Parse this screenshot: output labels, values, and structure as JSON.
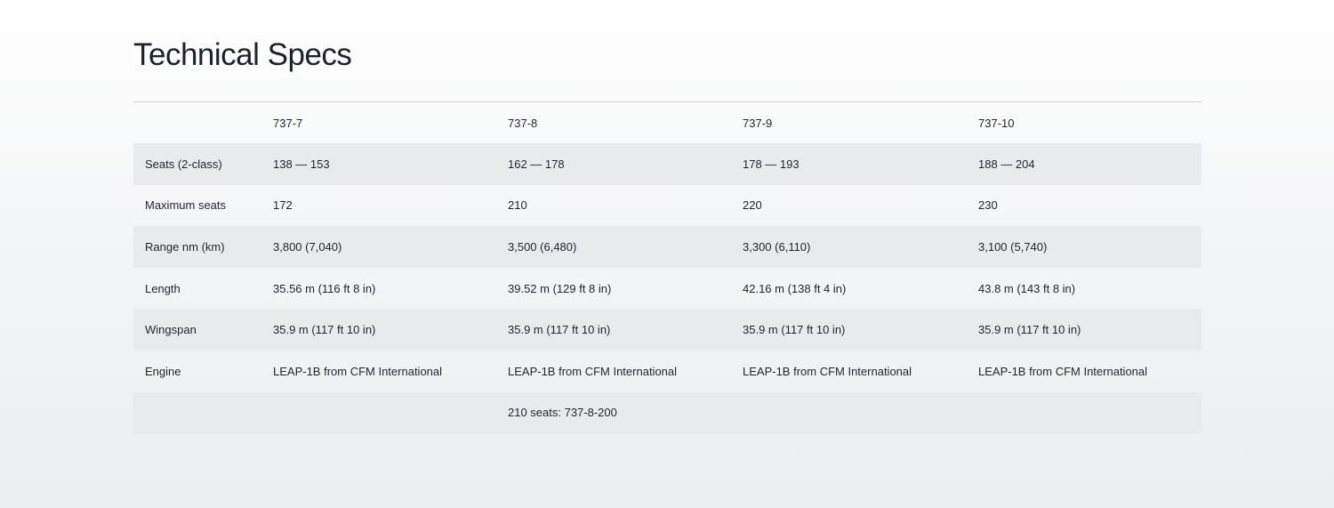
{
  "section": {
    "title": "Technical Specs"
  },
  "table": {
    "columns": [
      "",
      "737-7",
      "737-8",
      "737-9",
      "737-10"
    ],
    "rows": [
      {
        "label": "Seats (2-class)",
        "cells": [
          "138 — 153",
          "162 — 178",
          "178 — 193",
          "188 — 204"
        ]
      },
      {
        "label": "Maximum seats",
        "cells": [
          "172",
          "210",
          "220",
          "230"
        ]
      },
      {
        "label": "Range nm (km)",
        "cells": [
          "3,800 (7,040)",
          "3,500 (6,480)",
          "3,300 (6,110)",
          "3,100 (5,740)"
        ]
      },
      {
        "label": "Length",
        "cells": [
          "35.56 m (116 ft 8 in)",
          "39.52 m (129 ft 8 in)",
          "42.16 m (138 ft 4 in)",
          "43.8 m (143 ft 8 in)"
        ]
      },
      {
        "label": "Wingspan",
        "cells": [
          "35.9 m (117 ft 10 in)",
          "35.9 m (117 ft 10 in)",
          "35.9 m (117 ft 10 in)",
          "35.9 m (117 ft 10 in)"
        ]
      },
      {
        "label": "Engine",
        "cells": [
          "LEAP-1B from CFM International",
          "LEAP-1B from CFM International",
          "LEAP-1B from CFM International",
          "LEAP-1B from CFM International"
        ]
      },
      {
        "label": "",
        "cells": [
          "",
          "210 seats: 737-8-200",
          "",
          ""
        ]
      }
    ]
  }
}
